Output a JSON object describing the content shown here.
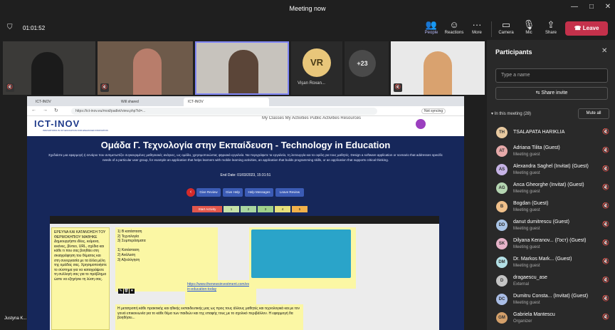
{
  "window": {
    "title": "Meeting now",
    "minimize": "—",
    "maximize": "□",
    "close": "✕"
  },
  "toolbar": {
    "timer": "01:01:52",
    "people": "People",
    "reactions": "Reactions",
    "more": "More",
    "camera": "Camera",
    "mic": "Mic",
    "share": "Share",
    "leave": "Leave"
  },
  "tiles": {
    "vr_initials": "VR",
    "vr_name": "Vişan Roxan...",
    "overflow": "+23",
    "bottom_left_name": "Justyna K..."
  },
  "browser": {
    "tabs": [
      "ICT-INOV",
      "Will shared",
      "ICT-INOV"
    ],
    "url": "https://ict-inov.eu/mod/padlet/view.php?id=...",
    "search": "Not syncing"
  },
  "site": {
    "logo": "ICT-INOV",
    "logo_sub": "INNOVATIONS IN ICT EDUCATION FOR ENHANCED INNOVATION",
    "nav": "My Classes  My Activities  Public Activities  Resources",
    "title": "Ομάδα Γ. Τεχνολογία στην Εκπαίδευση - Technology in Education",
    "description": "Σχεδιάστε μια εφαρμογή ή σενάριο που αντιμετωπίζει συγκεκριμένες μαθησιακές ανάγκες, ως ομάδα, χρησιμοποιώντας ψηφιακά εργαλεία. Να περιγράψετε τα εργαλεία, τη λειτουργία και τα οφέλη για τους μαθητές. Design a software application or scenario that addresses specific needs of a particular user group, for example an application that helps learners with mobile learning activities, an application that builds programming skills, or an application that supports critical thinking.",
    "end_date": "End Date: 01/03/2023, 15:31:51",
    "buttons": [
      "Give Review",
      "Give Help",
      "Help Messages",
      "Leave Review"
    ],
    "steps": [
      "Start Activity",
      "1",
      "2",
      "3",
      "4",
      "5"
    ],
    "notes": {
      "left": "ΕΡΕΥΝΑ ΚΑΙ ΚΑΤΑΝΟΗΣΗ ΤΟΥ ΘΕΡΜΟΚΗΠΙΟΥ ΜΑΘΗΚΕ Δημιουργήστε ιδέες, κείμενα, εικόνες, βίντεο, URL, σχέδια και κάθε τι που σας βοηθάει στη σκιαγράφηση του θέματος και στη συνεργασία με τα άλλα μέλη της ομάδας σας. Χρησιμοποιήστε το σύστημα για να καταγράψετε τη συλλογή σας για το πρόβλημα ώστε να εξηγήσει τη λύση σας.",
      "mid": "1) Β κατάσταση\n2) Τεχνολογία\n3) Συμπεράσματα\n\n1) Κατάσταση\n2) Ανάλυση\n3) Αξιολόγηση",
      "link": "https://www.thenewsinvestment.com/evolution-in-education-today",
      "bottom": "Η μετατροπή κάθε πρακτικής και ηθικής εκπαιδευτικής μας ως προς τους άλλους μαθητές και τεχνολογικά και με τον γονιό επικοινωνία για το κάθε θέμα των παιδιών και της επαφής τους με το σχολικό περιβάλλον. Η εφαρμογή θα βοηθήσει..."
    }
  },
  "participants": {
    "title": "Participants",
    "search_placeholder": "Type a name",
    "share_invite": "Share invite",
    "in_meeting": "In this meeting (28)",
    "mute_all": "Mute all",
    "list": [
      {
        "initials": "TH",
        "name": "TSALAPATA HARIKLIA",
        "role": "",
        "color": "#e8c9a0"
      },
      {
        "initials": "AT",
        "name": "Adriana Tilita (Guest)",
        "role": "Meeting guest",
        "color": "#e6a9a9"
      },
      {
        "initials": "AS",
        "name": "Alexandra Saghel (Invitat) (Guest)",
        "role": "Meeting guest",
        "color": "#c6b3e6"
      },
      {
        "initials": "AG",
        "name": "Anca Gheorghe (Invitat) (Guest)",
        "role": "Meeting guest",
        "color": "#b5d6b2"
      },
      {
        "initials": "B",
        "name": "Bogdan (Guest)",
        "role": "Meeting guest",
        "color": "#f0c08a"
      },
      {
        "initials": "DD",
        "name": "danut dumitrescu (Guest)",
        "role": "Meeting guest",
        "color": "#a9c4e6"
      },
      {
        "initials": "SK",
        "name": "Dilyana Keranov... (Гост) (Guest)",
        "role": "Meeting guest",
        "color": "#e6b3c9"
      },
      {
        "initials": "DM",
        "name": "Dr. Markos Mark... (Guest)",
        "role": "Meeting guest",
        "color": "#b3e0e6"
      },
      {
        "initials": "D",
        "name": "dragaescu_ase",
        "role": "External",
        "color": "#c4c4c4"
      },
      {
        "initials": "DC",
        "name": "Dumitru Consta... (Invitat) (Guest)",
        "role": "Meeting guest",
        "color": "#a9bde6"
      },
      {
        "initials": "GM",
        "name": "Gabriela Mantescu",
        "role": "Organizer",
        "color": "#d4a06a"
      }
    ]
  }
}
